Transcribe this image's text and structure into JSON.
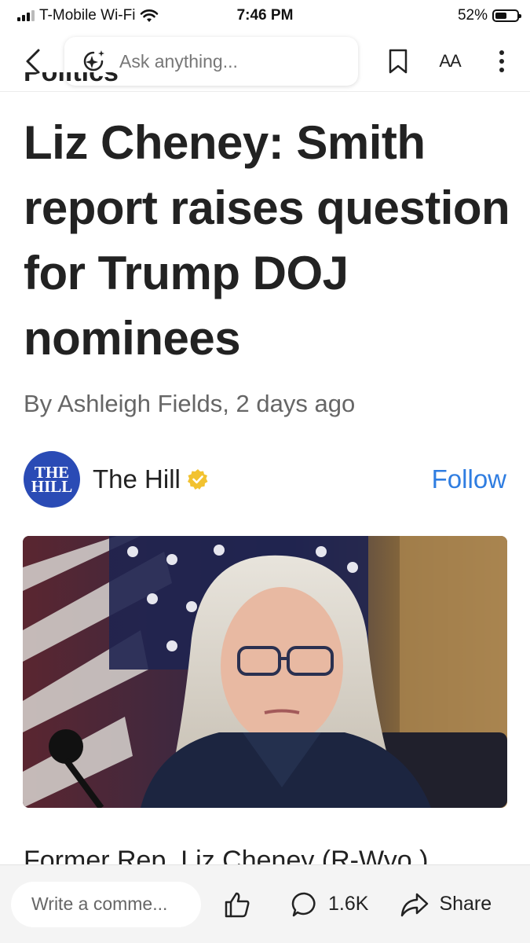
{
  "status_bar": {
    "carrier": "T-Mobile Wi-Fi",
    "time": "7:46 PM",
    "battery": "52%",
    "battery_level": 0.52
  },
  "nav": {
    "search_placeholder": "Ask anything...",
    "text_size_label": "AA",
    "icons": [
      "back-chevron-icon",
      "sparkle-icon",
      "bookmark-icon",
      "text-size-icon",
      "more-vertical-icon"
    ]
  },
  "article": {
    "category_cut": "Politics",
    "headline": "Liz Cheney: Smith report raises question for Trump DOJ nominees",
    "byline": "By Ashleigh Fields, 2 days ago",
    "publisher": {
      "logo_text_line1": "THE",
      "logo_text_line2": "HILL",
      "name": "The Hill",
      "follow_label": "Follow"
    },
    "body_first_line": "Former Rep. Liz Cheney (R-Wyo.)"
  },
  "bottom_bar": {
    "comment_placeholder": "Write a comme...",
    "comment_count": "1.6K",
    "share_label": "Share"
  },
  "colors": {
    "accent": "#2f7de1",
    "publisher_logo": "#2a4bb5",
    "verified_badge": "#f2c230"
  }
}
